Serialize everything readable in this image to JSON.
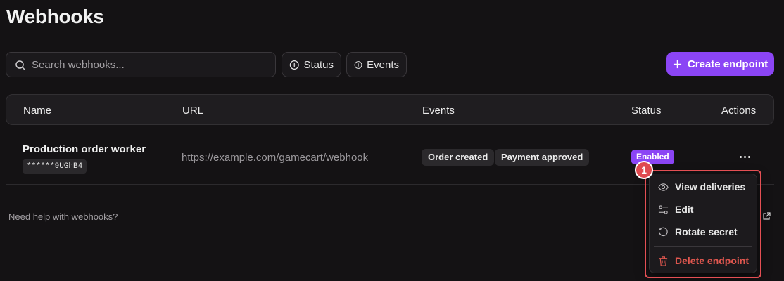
{
  "page": {
    "title": "Webhooks"
  },
  "toolbar": {
    "search_placeholder": "Search webhooks...",
    "status_filter": "Status",
    "events_filter": "Events",
    "create_label": "Create endpoint"
  },
  "table": {
    "columns": [
      "Name",
      "URL",
      "Events",
      "Status",
      "Actions"
    ],
    "rows": [
      {
        "name": "Production order worker",
        "secret": "******9UGhB4",
        "url": "https://example.com/gamecart/webhook",
        "events": [
          "Order created",
          "Payment approved"
        ],
        "status": "Enabled"
      }
    ]
  },
  "footer": {
    "help_text": "Need help with webhooks?"
  },
  "menu": {
    "items": [
      "View deliveries",
      "Edit",
      "Rotate secret",
      "Delete endpoint"
    ]
  },
  "annotation": {
    "marker": "1"
  },
  "colors": {
    "accent": "#8b45f5",
    "danger": "#e0574f",
    "highlight": "#e44f54",
    "background": "#141214"
  }
}
